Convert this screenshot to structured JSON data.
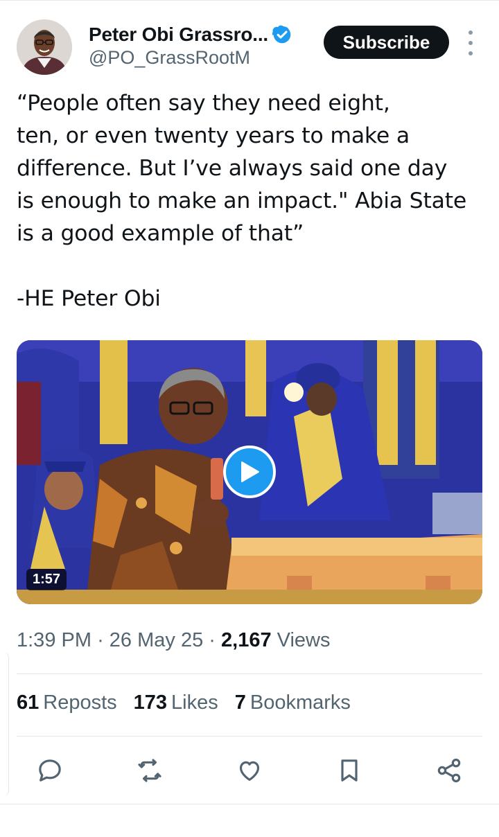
{
  "author": {
    "name": "Peter Obi Grassro...",
    "handle": "@PO_GrassRootM",
    "verified_color": "#1d9bf0"
  },
  "subscribe_label": "Subscribe",
  "tweet": {
    "text": "“People often say they need eight,\nten, or even twenty years to make a\ndifference. But I’ve always said one day\nis enough to make an impact.\" Abia State\nis a good example of that”\n\n-HE Peter Obi"
  },
  "media": {
    "duration": "1:57",
    "play_icon": "play-icon"
  },
  "meta": {
    "time": "1:39 PM",
    "sep": "·",
    "date": "26 May 25",
    "views_count": "2,167",
    "views_label": "Views"
  },
  "stats": {
    "reposts_count": "61",
    "reposts_label": "Reposts",
    "likes_count": "173",
    "likes_label": "Likes",
    "bookmarks_count": "7",
    "bookmarks_label": "Bookmarks"
  },
  "actions": [
    "reply-icon",
    "repost-icon",
    "like-icon",
    "bookmark-icon",
    "share-icon"
  ],
  "colors": {
    "text": "#0f1419",
    "secondary": "#536471",
    "accent": "#1d9bf0",
    "divider": "#e3e6ea"
  }
}
